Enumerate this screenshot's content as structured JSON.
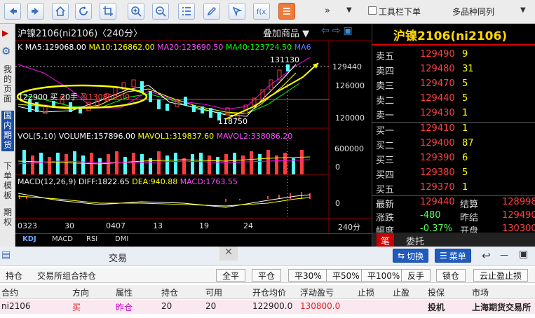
{
  "toolbar": {
    "buttons": [
      "back",
      "forward",
      "home",
      "refresh",
      "crop",
      "zoom-in",
      "zoom-out",
      "grid",
      "pen",
      "draw",
      "formula",
      "list"
    ],
    "more": "»",
    "dropdown": "▼",
    "toolbar_below_label": "工具栏下单",
    "multi_variety_label": "多品种同列"
  },
  "left_nav": {
    "items": [
      "我的页面",
      "国内期货",
      "下单模板",
      "期权"
    ]
  },
  "chart": {
    "title": "沪镍2106(ni2106)〈240分〉",
    "overlay_label": "叠加商品",
    "k_header": {
      "k": "K",
      "ma5": "MA5:129068.00",
      "ma10": "MA10:126862.00",
      "ma20": "MA20:123690.50",
      "ma40": "MA40:123724.50",
      "ma6": "MA6"
    },
    "price_high_label": "131130",
    "price_low_label": "118750",
    "price_ticks": [
      "129440",
      "126000",
      "120000"
    ],
    "annotation": "122900 买 20手",
    "annotation_profit": "盈130800.00",
    "vol_header": {
      "vol": "VOL(5,10)",
      "volume": "VOLUME:157896.00",
      "mavol1": "MAVOL1:319837.60",
      "mavol2": "MAVOL2:338086.20"
    },
    "vol_ticks": [
      "600000",
      "0"
    ],
    "macd_header": {
      "macd": "MACD(12,26,9)",
      "diff": "DIFF:1822.65",
      "dea": "DEA:940.88",
      "macd_val": "MACD:1763.55"
    },
    "macd_ticks": [
      "0"
    ],
    "dates": [
      "0323",
      "30",
      "0407",
      "13",
      "19",
      "24",
      "240分"
    ],
    "indicator_tabs": [
      "KDJ",
      "MACD",
      "RSI",
      "DMI"
    ],
    "colors": {
      "up": "#ff3c3c",
      "down": "#54ffff",
      "ma5": "#ffffff",
      "ma10": "#ffff00",
      "ma20": "#ff00ff",
      "ma40": "#00ff00"
    }
  },
  "quote": {
    "title": "沪镍2106(ni2106)",
    "asks": [
      {
        "label": "卖五",
        "price": "129490",
        "vol": "9"
      },
      {
        "label": "卖四",
        "price": "129480",
        "vol": "31"
      },
      {
        "label": "卖三",
        "price": "129470",
        "vol": "5"
      },
      {
        "label": "卖二",
        "price": "129440",
        "vol": "5"
      },
      {
        "label": "卖一",
        "price": "129430",
        "vol": "1"
      }
    ],
    "bids": [
      {
        "label": "买一",
        "price": "129410",
        "vol": "1"
      },
      {
        "label": "买二",
        "price": "129400",
        "vol": "87"
      },
      {
        "label": "买三",
        "price": "129390",
        "vol": "6"
      },
      {
        "label": "买四",
        "price": "129380",
        "vol": "5"
      },
      {
        "label": "买五",
        "price": "129370",
        "vol": "1"
      }
    ],
    "stats": [
      {
        "l1": "最新",
        "v1": "129440",
        "l2": "结算",
        "v2": "128998"
      },
      {
        "l1": "涨跌",
        "v1": "-480",
        "l2": "昨结",
        "v2": "129490"
      },
      {
        "l1": "幅度",
        "v1": "-0.37%",
        "l2": "开盘",
        "v2": "130300"
      }
    ],
    "tabs": [
      "笔",
      "委托"
    ]
  },
  "trade": {
    "title": "交易",
    "switch_label": "切换",
    "menu_label": "菜单",
    "tabs": [
      "持仓",
      "交易所组合持仓"
    ],
    "actions": [
      "全平",
      "平仓",
      "平30%",
      "平50%",
      "平100%",
      "反手",
      "锁仓",
      "云止盈止损"
    ],
    "columns": [
      "合约",
      "方向",
      "属性",
      "持仓",
      "可用",
      "开仓均价",
      "浮动盈亏",
      "止损",
      "止盈",
      "投保",
      "市场"
    ],
    "rows": [
      [
        "ni2106",
        "买",
        "昨仓",
        "20",
        "20",
        "122900.0",
        "130800.0",
        "",
        "",
        "投机",
        "上海期货交易所"
      ]
    ]
  }
}
